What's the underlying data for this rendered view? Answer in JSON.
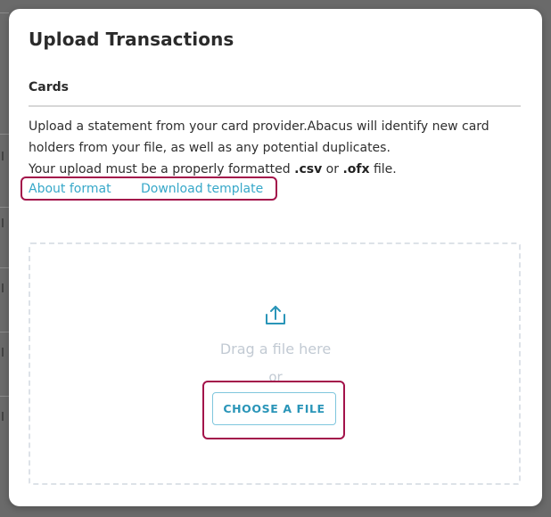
{
  "modal": {
    "title": "Upload Transactions",
    "section_label": "Cards",
    "description": {
      "line1": "Upload a statement from your card provider.Abacus will identify new card holders from your file, as well as any potential duplicates.",
      "line2_prefix": "Your upload must be a properly formatted ",
      "csv": ".csv",
      "or_word": " or ",
      "ofx": ".ofx",
      "line2_suffix": " file."
    },
    "links": {
      "about_format": "About format",
      "download_template": "Download template"
    },
    "dropzone": {
      "icon": "upload-icon",
      "drag_text": "Drag a file here",
      "or_text": "or",
      "choose_button": "CHOOSE A FILE"
    }
  },
  "colors": {
    "link": "#37a8c9",
    "highlight": "#a3124a",
    "button_text": "#2a95b8",
    "muted_text": "#c2cad3"
  }
}
